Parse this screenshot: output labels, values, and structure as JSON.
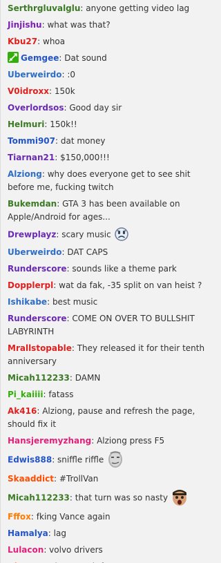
{
  "messages": [
    {
      "user": "Serthrgluvalglu",
      "color": "#3c7a25",
      "text": "anyone getting video lag"
    },
    {
      "user": "Jinjishu",
      "color": "#7c1fb8",
      "text": "what was that?"
    },
    {
      "user": "Kbu27",
      "color": "#e0201e",
      "text": "whoa"
    },
    {
      "user": "Gemgee",
      "color": "#2354c6",
      "text": "Dat sound",
      "badge": "moderator-sword-icon"
    },
    {
      "user": "Uberweirdo",
      "color": "#2f6ec4",
      "text": ":0"
    },
    {
      "user": "V0idroxx",
      "color": "#e0201e",
      "text": "150k"
    },
    {
      "user": "Overlordsos",
      "color": "#6a2bb3",
      "text": "Good day sir"
    },
    {
      "user": "Helmuri",
      "color": "#3c7a25",
      "text": "150k!!"
    },
    {
      "user": "Tommi907",
      "color": "#2354c6",
      "text": "dat money"
    },
    {
      "user": "Tiarnan21",
      "color": "#6a2bb3",
      "text": "$150,000!!!"
    },
    {
      "user": "Alziong",
      "color": "#2f6ec4",
      "text": "why does everyone get to see shit before me, fucking twitch"
    },
    {
      "user": "Bukemdan",
      "color": "#3c7a25",
      "text": "GTA 3 has been available on Apple/Android for ages..."
    },
    {
      "user": "Drewplayz",
      "color": "#6a2bb3",
      "text": "scary music",
      "emote": "sad-face-emote-icon"
    },
    {
      "user": "Uberweirdo",
      "color": "#2f6ec4",
      "text": "DAT CAPS"
    },
    {
      "user": "Runderscore",
      "color": "#6a2bb3",
      "text": "sounds like a theme park"
    },
    {
      "user": "Dopplerpl",
      "color": "#e0201e",
      "text": "wat da fak, -35 split on van heist ?"
    },
    {
      "user": "Ishikabe",
      "color": "#2f6ec4",
      "text": "best music"
    },
    {
      "user": "Runderscore",
      "color": "#6a2bb3",
      "text": "COME ON OVER TO BULLSHIT LABYRINTH"
    },
    {
      "user": "Mrallstopable",
      "color": "#e0201e",
      "text": "They released it for their tenth anniversary"
    },
    {
      "user": "Micah112233",
      "color": "#3c7a25",
      "text": "DAMN"
    },
    {
      "user": "Pi_kaiiii",
      "color": "#34ae0a",
      "text": "fatass"
    },
    {
      "user": "Ak416",
      "color": "#e0201e",
      "text": "Alziong, pause and refresh the page, should fix it"
    },
    {
      "user": "Hansjeremyzhang",
      "color": "#e0217a",
      "text": "Alziong press F5"
    },
    {
      "user": "Edwis888",
      "color": "#2354c6",
      "text": "sniffle riffle",
      "emote": "kappa-face-emote-icon"
    },
    {
      "user": "Skaaddict",
      "color": "#ff4e00",
      "text": "#TrollVan"
    },
    {
      "user": "Micah112233",
      "color": "#3c7a25",
      "text": "that turn was so nasty",
      "emote": "wowee-face-emote-icon"
    },
    {
      "user": "Fffox",
      "color": "#ff7a00",
      "text": "fking Vance again"
    },
    {
      "user": "Hamalya",
      "color": "#2354c6",
      "text": "lag"
    },
    {
      "user": "Lulacon",
      "color": "#e0217a",
      "text": "volvo drivers"
    },
    {
      "user": "Ubererer",
      "color": "#ff4e00",
      "text": "i cant wait for gtaV"
    }
  ]
}
